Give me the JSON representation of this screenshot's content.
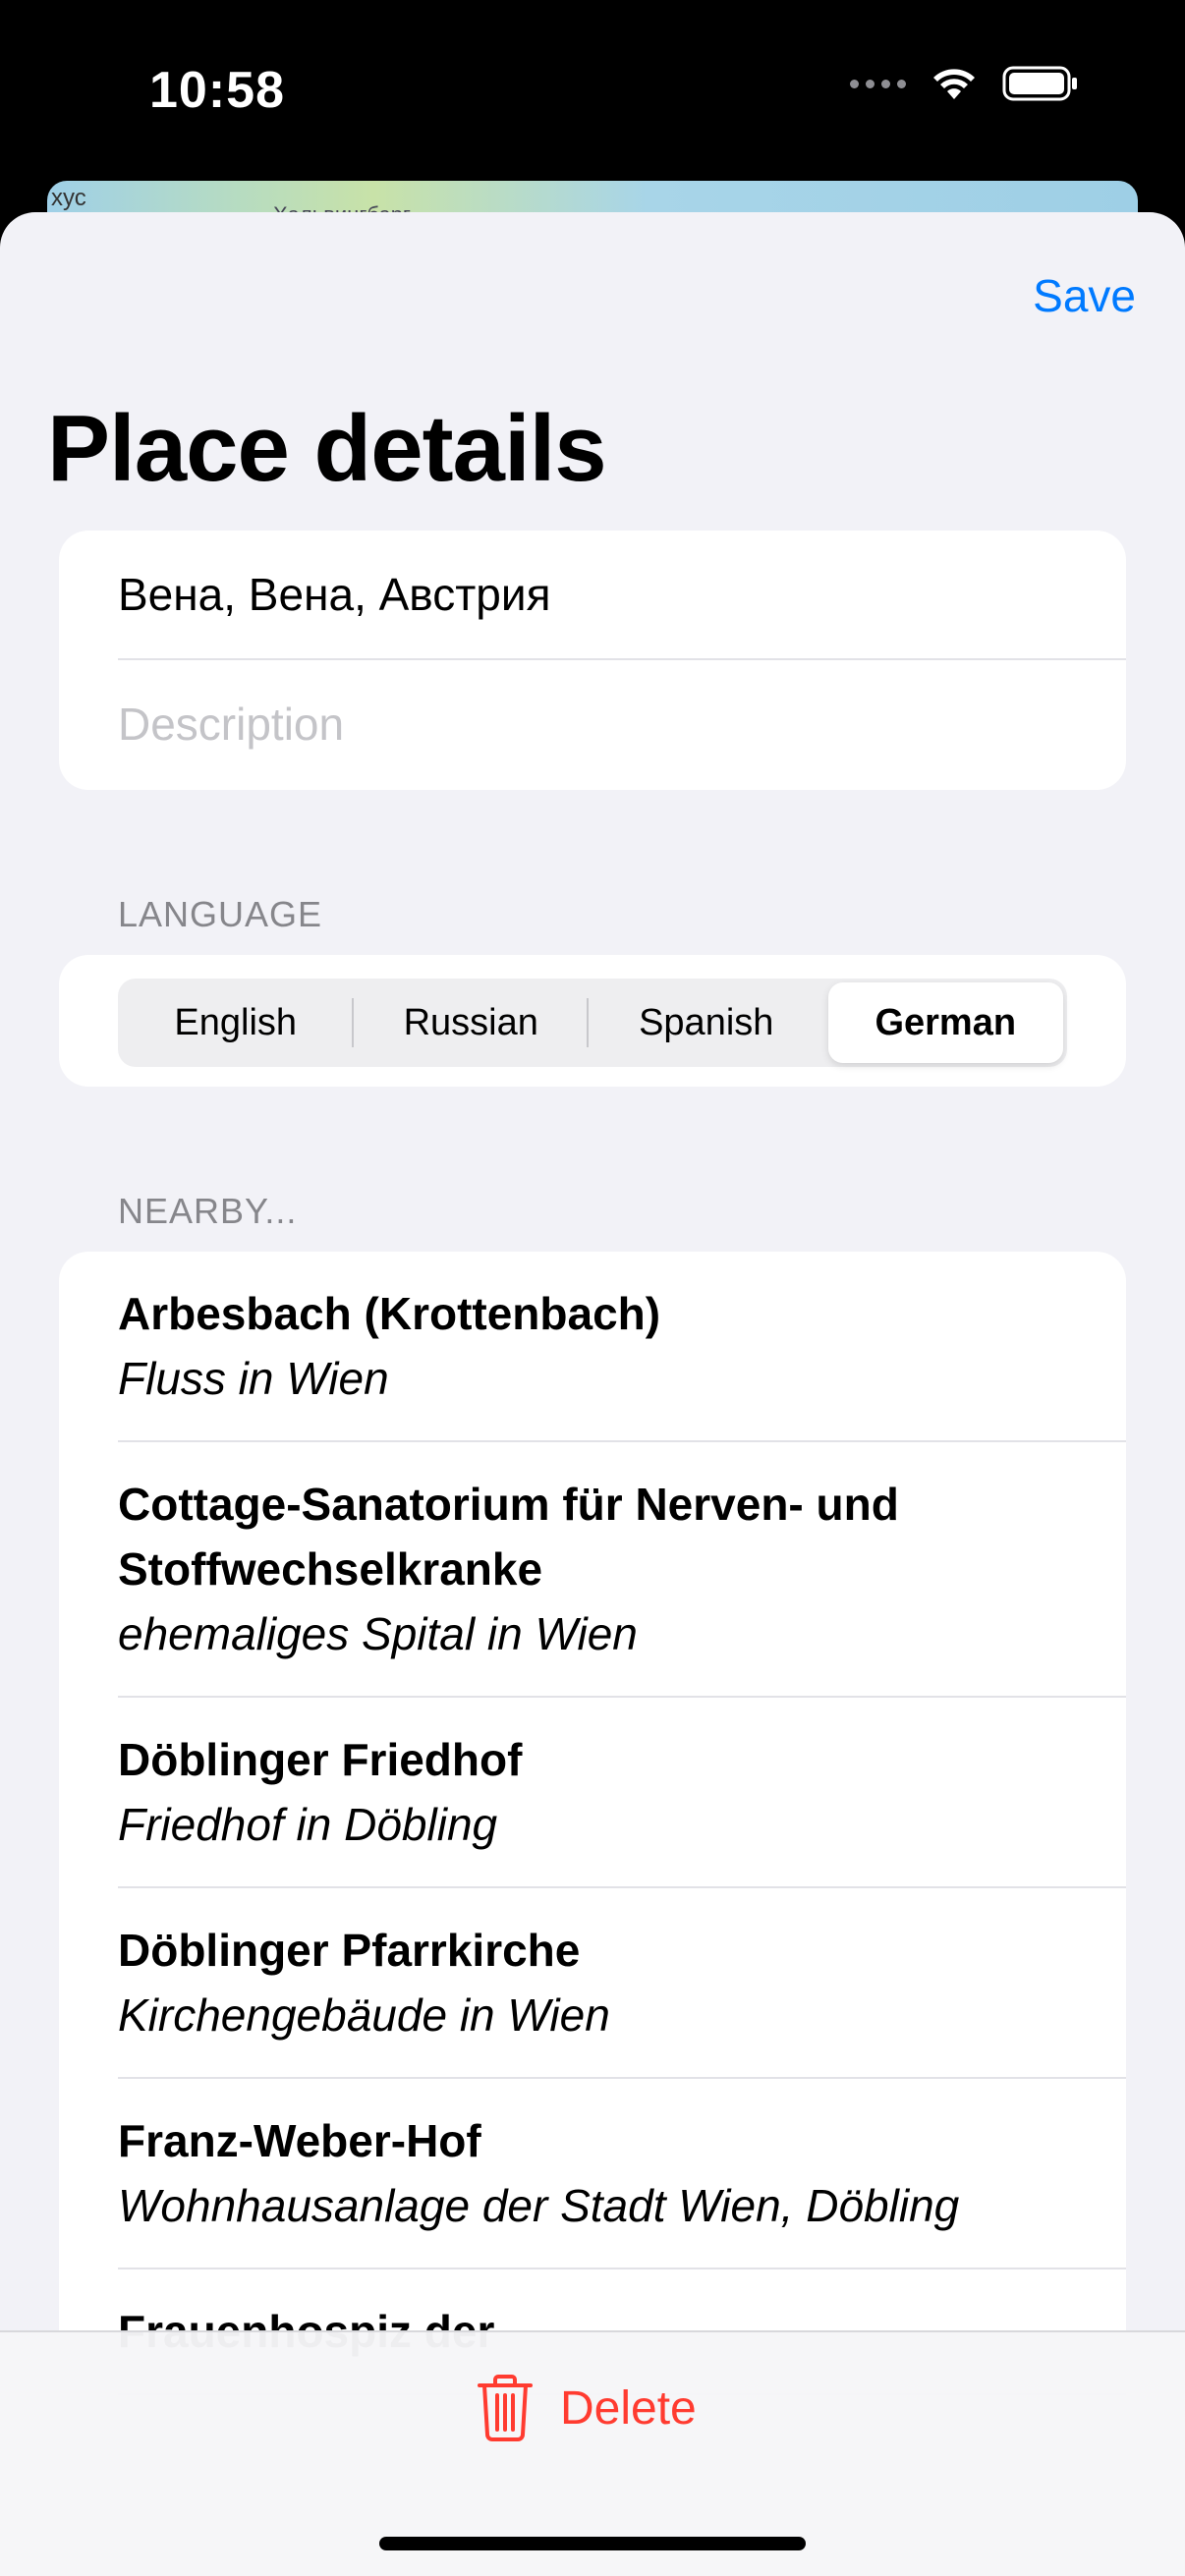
{
  "status_bar": {
    "time": "10:58"
  },
  "map": {
    "label_left": "хус",
    "label_mid": "Хальвингбарг"
  },
  "header": {
    "save_label": "Save",
    "title": "Place details"
  },
  "fields": {
    "name_value": "Вена, Вена, Австрия",
    "description_placeholder": "Description"
  },
  "language": {
    "section_label": "LANGUAGE",
    "options": [
      "English",
      "Russian",
      "Spanish",
      "German"
    ],
    "selected": "German"
  },
  "nearby": {
    "section_label": "NEARBY...",
    "items": [
      {
        "title": "Arbesbach (Krottenbach)",
        "subtitle": "Fluss in Wien"
      },
      {
        "title": "Cottage-Sanatorium für Nerven- und Stoffwechselkranke",
        "subtitle": "ehemaliges Spital in Wien"
      },
      {
        "title": "Döblinger Friedhof",
        "subtitle": "Friedhof in Döbling"
      },
      {
        "title": "Döblinger Pfarrkirche",
        "subtitle": "Kirchengebäude in Wien"
      },
      {
        "title": "Franz-Weber-Hof",
        "subtitle": "Wohnhausanlage der Stadt Wien, Döbling"
      },
      {
        "title": "Frauenhospiz der",
        "subtitle": ""
      }
    ]
  },
  "toolbar": {
    "delete_label": "Delete"
  },
  "colors": {
    "accent": "#007aff",
    "destructive": "#ff3b30",
    "background": "#f2f2f7"
  },
  "icons": {
    "wifi": "wifi-icon",
    "battery": "battery-icon",
    "trash": "trash-icon"
  }
}
